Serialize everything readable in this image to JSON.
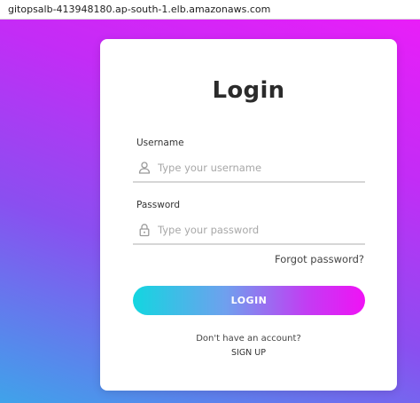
{
  "browser": {
    "url": "gitopsalb-413948180.ap-south-1.elb.amazonaws.com"
  },
  "colors": {
    "background_gradient": [
      "#3fa3ea",
      "#8a4ff0",
      "#e91ef8"
    ],
    "button_gradient": [
      "#13d6e0",
      "#f012f5"
    ],
    "card": "#ffffff",
    "title": "#2b2b2b"
  },
  "login_form": {
    "title": "Login",
    "username": {
      "label": "Username",
      "placeholder": "Type your username",
      "value": "",
      "icon": "user-icon"
    },
    "password": {
      "label": "Password",
      "placeholder": "Type your password",
      "value": "",
      "icon": "lock-icon"
    },
    "forgot_password": "Forgot password?",
    "login_button": "LOGIN",
    "no_account_text": "Don't have an account?",
    "signup_link": "SIGN UP"
  }
}
